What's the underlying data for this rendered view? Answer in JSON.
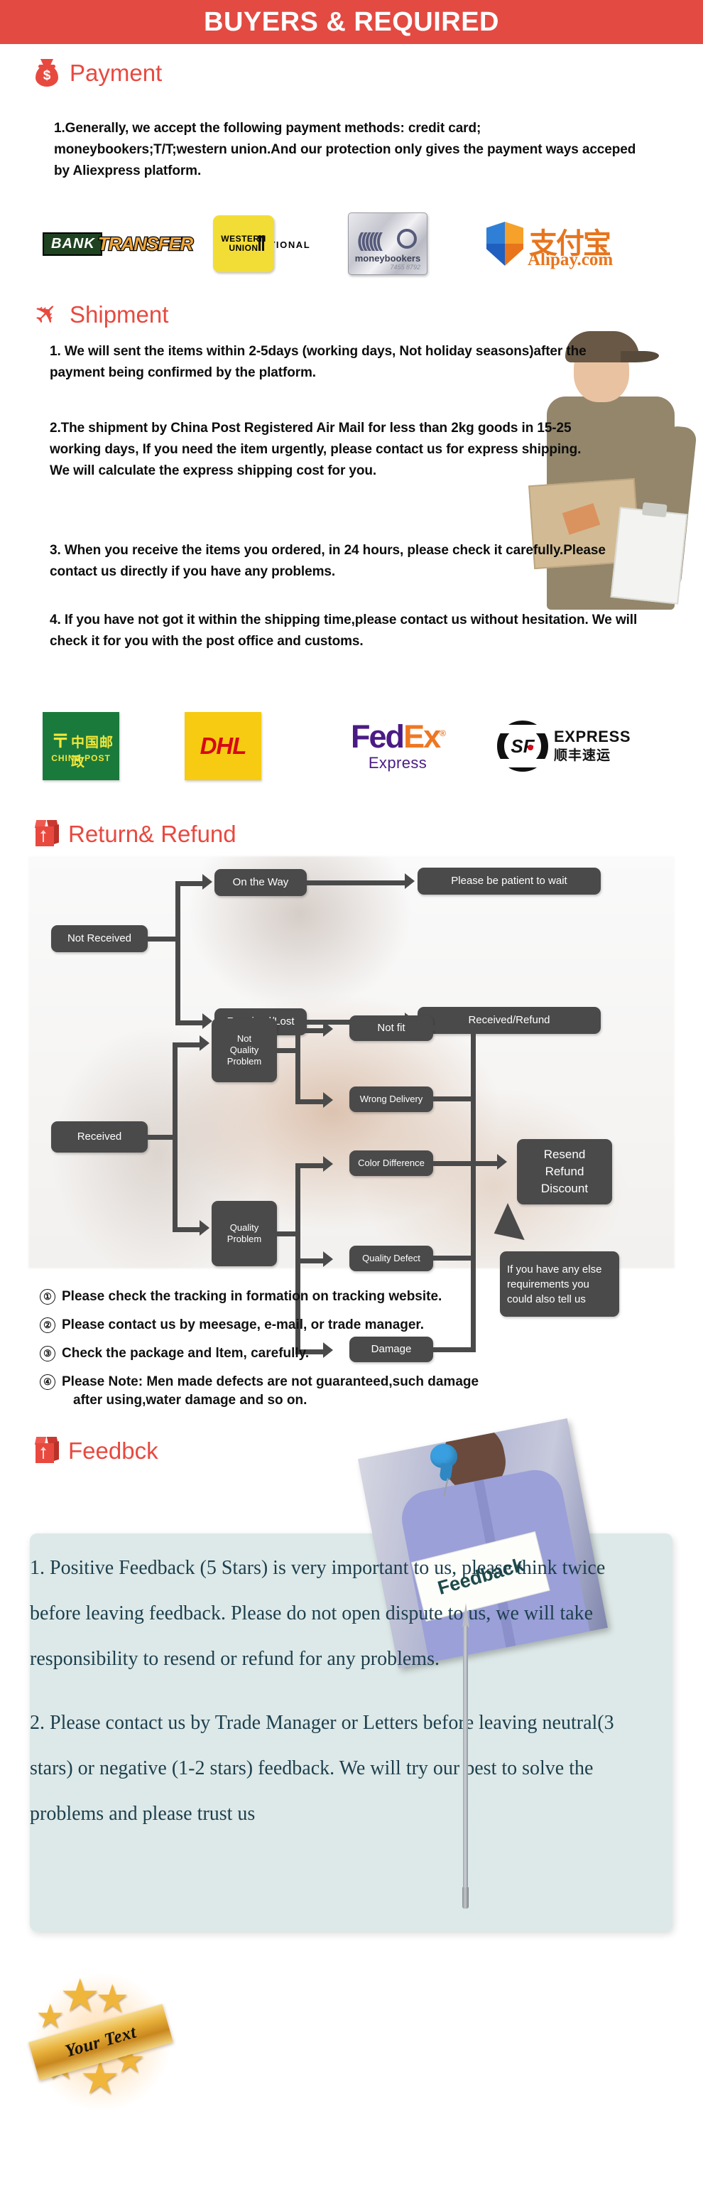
{
  "banner": {
    "title": "BUYERS & REQUIRED"
  },
  "payment": {
    "heading": "Payment",
    "icon": "money-bag-icon",
    "body": "1.Generally, we accept the following payment methods: credit card; moneybookers;T/T;western union.And our protection only gives the payment ways acceped by Aliexpress platform.",
    "logos": [
      {
        "name": "bank-transfer-logo",
        "word1": "BANK",
        "word2": "TRANSFER",
        "sub": "INTERNATIONAL"
      },
      {
        "name": "western-union-logo",
        "line1": "WESTERN",
        "line2": "UNION"
      },
      {
        "name": "moneybookers-logo",
        "label": "moneybookers",
        "card_number": "7455 8792"
      },
      {
        "name": "alipay-logo",
        "cn": "支付宝",
        "label": "Alipay.com"
      }
    ]
  },
  "shipment": {
    "heading": "Shipment",
    "icon": "airplane-icon",
    "paragraphs": [
      "1. We will sent the items within 2-5days (working days, Not holiday seasons)after the payment being confirmed by the platform.",
      "2.The shipment by China Post Registered Air Mail for less than  2kg goods in 15-25 working days, If  you need the item urgently, please contact us for express shipping.\nWe will calculate the express shipping cost for you.",
      "3. When you receive the items you ordered, in 24 hours, please check  it carefully.Please contact us directly if you have any problems.",
      "4. If you have not got it within the shipping time,please contact us without hesitation. We will check it for you with the post office and customs."
    ],
    "carriers": [
      {
        "name": "china-post-logo",
        "cn": "中国邮政",
        "en": "CHINA POST"
      },
      {
        "name": "dhl-logo",
        "label": "DHL"
      },
      {
        "name": "fedex-logo",
        "part1": "Fed",
        "part2": "Ex",
        "sub": "Express"
      },
      {
        "name": "sf-express-logo",
        "mark": "SF",
        "en": "EXPRESS",
        "cn": "顺丰速运"
      }
    ]
  },
  "return_refund": {
    "heading": "Return& Refund",
    "icon": "package-box-icon",
    "flowchart": {
      "not_received": "Not Received",
      "on_the_way": "On the Way",
      "please_wait": "Please be patient to wait",
      "received_lost": "Received/Lost",
      "received_refund": "Received/Refund",
      "received": "Received",
      "not_quality_problem": "Not\nQuality\nProblem",
      "quality_problem": "Quality\nProblem",
      "not_fit": "Not fit",
      "wrong_delivery": "Wrong Delivery",
      "color_difference": "Color Difference",
      "quality_defect": "Quality Defect",
      "damage": "Damage",
      "resend_refund_discount": "Resend\nRefund\nDiscount",
      "callout": "If you have any else\nrequirements you\ncould also tell us"
    },
    "notes": [
      {
        "marker": "①",
        "text": "Please check the tracking in formation on tracking website.",
        "line2": ""
      },
      {
        "marker": "②",
        "text": "Please contact us by meesage, e-mail, or trade manager.",
        "line2": ""
      },
      {
        "marker": "③",
        "text": "Check the package and ltem, carefully.",
        "line2": ""
      },
      {
        "marker": "④",
        "text": "Please Note: Men made defects  are not guaranteed,such damage",
        "line2": "after using,water damage and so on."
      }
    ]
  },
  "feedback": {
    "heading": "Feedbck",
    "icon": "package-box-icon",
    "photo_sign_text": "Feedback",
    "paragraphs": [
      "1. Positive Feedback (5 Stars) is very important to us, please think twice before leaving feedback. Please do not open dispute to us,   we will take responsibility to resend or refund for any problems.",
      "2. Please contact us by Trade Manager or Letters before leaving neutral(3 stars) or negative (1-2 stars) feedback. We will try our best to solve the problems and please trust us"
    ],
    "badge_text": "Your Text"
  },
  "colors": {
    "banner_red": "#e34a42",
    "heading_red": "#e8493f",
    "node_gray": "#4a4a4a",
    "feedback_card": "#dde9e8",
    "feedback_text": "#1d3f4d",
    "badge_gold": "#e8b23c"
  }
}
